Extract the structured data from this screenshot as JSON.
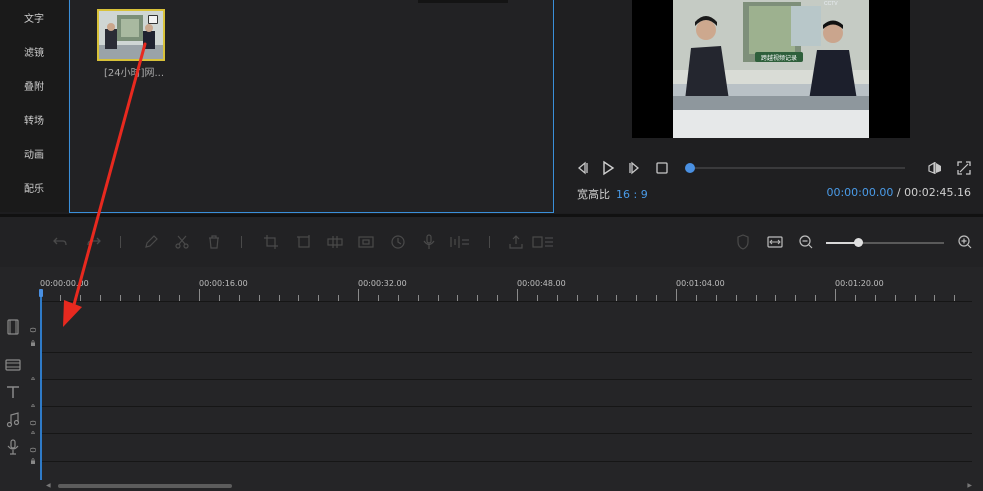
{
  "sidebar": {
    "items": [
      {
        "label": "文字"
      },
      {
        "label": "滤镜"
      },
      {
        "label": "叠附"
      },
      {
        "label": "转场"
      },
      {
        "label": "动画"
      },
      {
        "label": "配乐"
      }
    ]
  },
  "media": {
    "clip": {
      "label": "[24小时]网..."
    }
  },
  "preview": {
    "aspect_label": "宽高比",
    "aspect_value": "16 : 9",
    "current_time": "00:00:00.00",
    "separator": "/",
    "total_time": "00:02:45.16",
    "progress_fraction": 0.0,
    "frame_caption": "跨越视频记录",
    "frame_logo": "CCTV"
  },
  "toolbar": {
    "zoom_fraction": 0.27
  },
  "timeline": {
    "ruler_labels": [
      "00:00:00.00",
      "00:00:16.00",
      "00:00:32.00",
      "00:00:48.00",
      "00:01:04.00",
      "00:01:20.00"
    ],
    "tracks": [
      {
        "name": "video-track-main",
        "icon": "film-icon"
      },
      {
        "name": "video-track-overlay",
        "icon": "film-icon"
      },
      {
        "name": "text-track",
        "icon": "text-icon"
      },
      {
        "name": "music-track",
        "icon": "music-icon"
      },
      {
        "name": "voice-track",
        "icon": "microphone-icon"
      }
    ]
  },
  "colors": {
    "accent": "#4a90e2",
    "selection": "#d8c23a",
    "annotation": "#e8291f"
  }
}
